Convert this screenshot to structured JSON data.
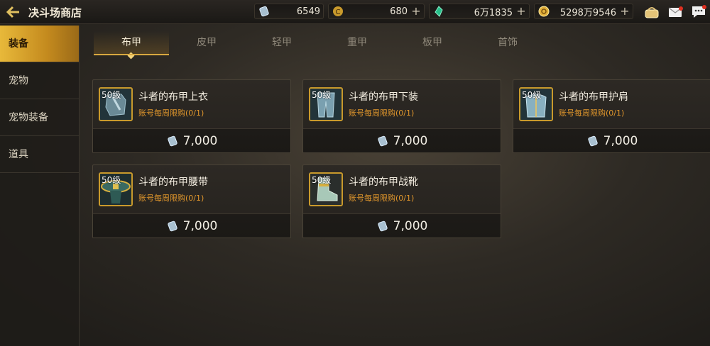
{
  "header": {
    "title": "决斗场商店",
    "currencies": [
      {
        "icon": "crystal-ticket-icon",
        "value": "6549",
        "plus": ""
      },
      {
        "icon": "gold-coin-c-icon",
        "value": "680",
        "plus": "+"
      },
      {
        "icon": "green-gem-icon",
        "value": "6万1835",
        "plus": "+"
      },
      {
        "icon": "gold-coin-icon",
        "value": "5298万9546",
        "plus": "+"
      }
    ]
  },
  "sidebar": {
    "items": [
      {
        "label": "装备"
      },
      {
        "label": "宠物"
      },
      {
        "label": "宠物装备"
      },
      {
        "label": "道具"
      }
    ]
  },
  "tabs": [
    {
      "label": "布甲"
    },
    {
      "label": "皮甲"
    },
    {
      "label": "轻甲"
    },
    {
      "label": "重甲"
    },
    {
      "label": "板甲"
    },
    {
      "label": "首饰"
    }
  ],
  "items": [
    {
      "level": "50级",
      "name": "斗者的布甲上衣",
      "limit": "账号每周限购(0/1)",
      "price": "7,000",
      "icon": "cloth-top-icon"
    },
    {
      "level": "50级",
      "name": "斗者的布甲下装",
      "limit": "账号每周限购(0/1)",
      "price": "7,000",
      "icon": "cloth-pants-icon"
    },
    {
      "level": "50级",
      "name": "斗者的布甲护肩",
      "limit": "账号每周限购(0/1)",
      "price": "7,000",
      "icon": "cloth-shoulder-icon"
    },
    {
      "level": "50级",
      "name": "斗者的布甲腰带",
      "limit": "账号每周限购(0/1)",
      "price": "7,000",
      "icon": "cloth-belt-icon"
    },
    {
      "level": "50级",
      "name": "斗者的布甲战靴",
      "limit": "账号每周限购(0/1)",
      "price": "7,000",
      "icon": "cloth-boots-icon"
    }
  ],
  "colors": {
    "accent": "#d8a840",
    "limit_text": "#e0962c",
    "active_nav": "#e8b93a"
  }
}
